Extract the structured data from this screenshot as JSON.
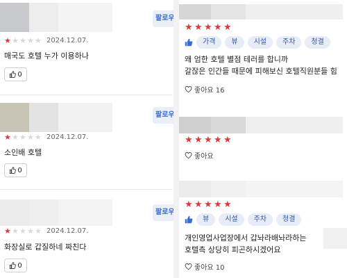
{
  "follow_label": "팔로우",
  "colors": {
    "star": "#e0363a",
    "tag_bg": "#e7ecf6",
    "tag_text": "#2f58a8",
    "follow_bg": "#e9eef7"
  },
  "left_reviews": [
    {
      "rating": 1,
      "date": "2024.12.07.",
      "text": "매국도 호텔 누가 이용하나",
      "likes": "0"
    },
    {
      "rating": 1,
      "date": "2024.12.07.",
      "text": "소인배 호텔",
      "likes": "0"
    },
    {
      "rating": 1,
      "date": "2024.12.07.",
      "text": "화장실로 갑질하네 짜친다",
      "likes": "0"
    }
  ],
  "right_reviews": [
    {
      "rating": 5,
      "tags": [
        "가격",
        "뷰",
        "시설",
        "주차",
        "청결"
      ],
      "lines": [
        "왜 엄한 호텔 별점 테러를 합니까",
        "갈잖은 인간들 때문에 피해보신 호텔직원분들 힘"
      ],
      "likes_label": "좋아요 16"
    },
    {
      "rating": 5,
      "tags": [],
      "lines": [],
      "likes_label": "좋아요"
    },
    {
      "rating": 5,
      "tags": [
        "뷰",
        "시설",
        "주차",
        "청결"
      ],
      "lines": [
        "개인영업사업장에서 갑놔라배놔라하는",
        "호텔측 상당히 피곤하시겠어요"
      ],
      "likes_label": "좋아요 10"
    }
  ]
}
